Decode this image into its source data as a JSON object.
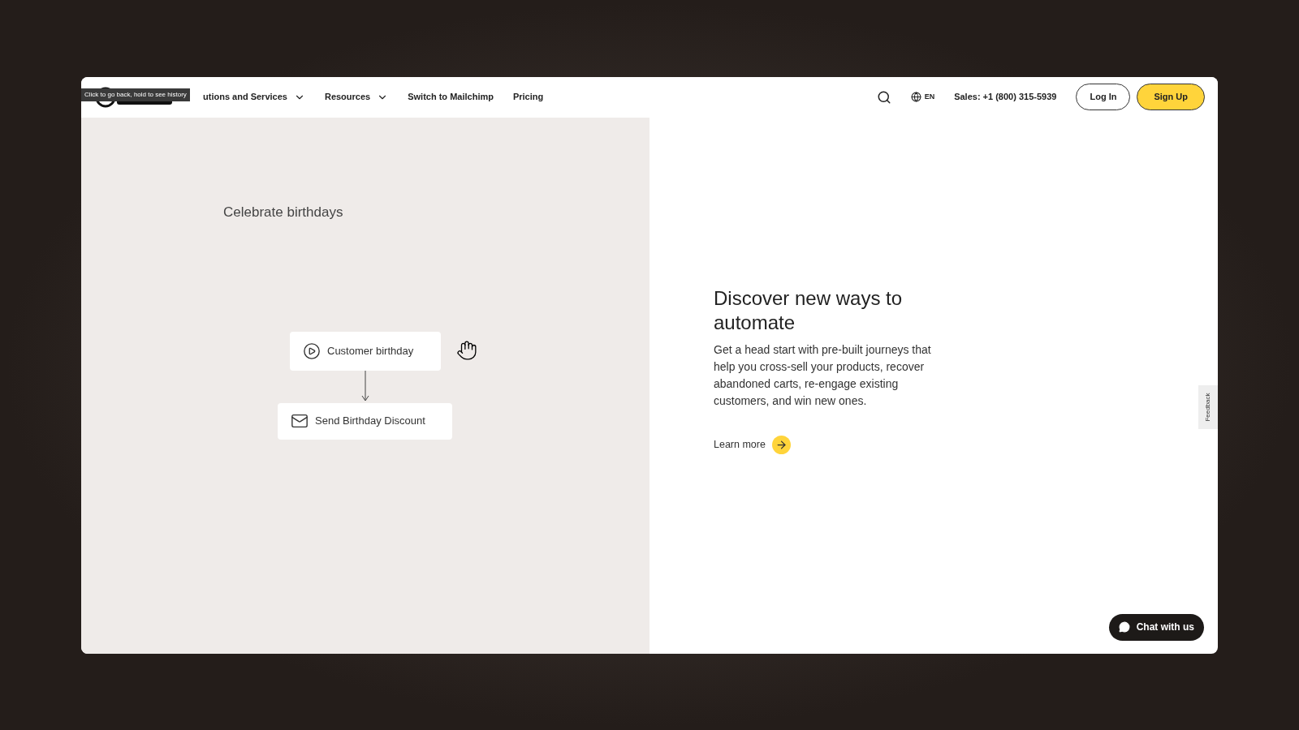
{
  "tooltip": {
    "text": "Click to go back, hold to see history"
  },
  "nav": {
    "items": [
      {
        "label": "utions and Services",
        "dropdown": true
      },
      {
        "label": "Resources",
        "dropdown": true
      },
      {
        "label": "Switch to Mailchimp",
        "dropdown": false
      },
      {
        "label": "Pricing",
        "dropdown": false
      }
    ],
    "language": "EN",
    "sales": "Sales: +1 (800) 315-5939",
    "login": "Log In",
    "signup": "Sign Up"
  },
  "illustration": {
    "title": "Celebrate birthdays",
    "trigger": "Customer birthday",
    "action": "Send Birthday Discount"
  },
  "hero": {
    "heading": "Discover new ways to automate",
    "body": "Get a head start with pre-built journeys that help you cross-sell your products, recover abandoned carts, re-engage existing customers, and win new ones.",
    "link": "Learn more"
  },
  "feedback": "Feedback",
  "chat": "Chat with us"
}
